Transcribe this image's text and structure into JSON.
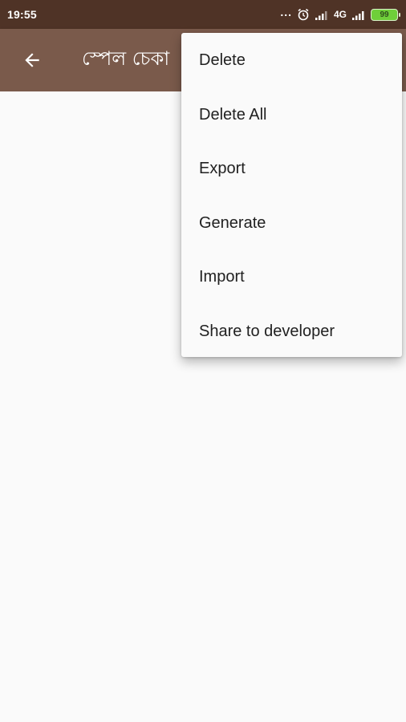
{
  "status_bar": {
    "time": "19:55",
    "dots": "...",
    "network": "4G",
    "battery": "99",
    "colors": {
      "background": "#4f3326",
      "battery": "#6fcf3a"
    }
  },
  "toolbar": {
    "title": "স্পেল চেকা",
    "back_icon": "arrow-back-icon",
    "colors": {
      "background": "#7a5a4b"
    }
  },
  "menu": {
    "items": [
      "Delete",
      "Delete All",
      "Export",
      "Generate",
      "Import",
      "Share to developer"
    ]
  }
}
